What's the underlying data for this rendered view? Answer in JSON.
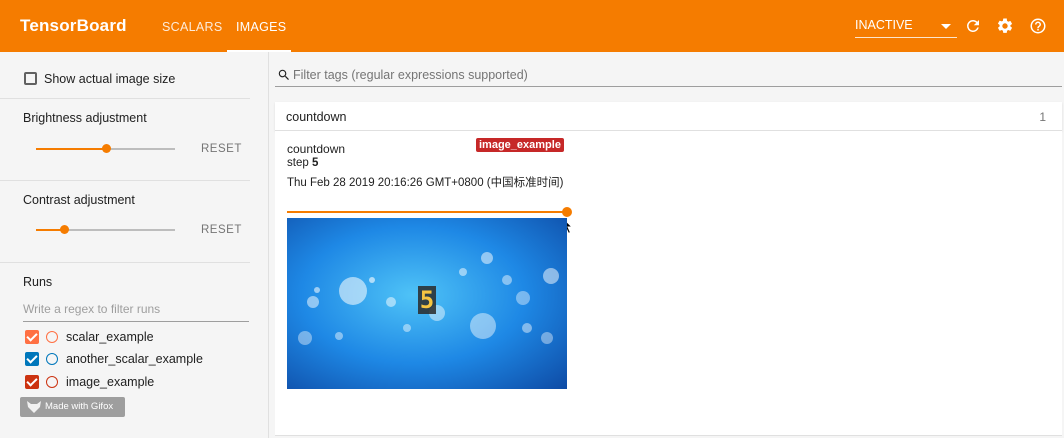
{
  "header": {
    "brand": "TensorBoard",
    "tabs": [
      {
        "label": "SCALARS",
        "active": false
      },
      {
        "label": "IMAGES",
        "active": true
      }
    ],
    "run_selector_value": "INACTIVE",
    "icons": [
      "refresh-icon",
      "gear-icon",
      "help-icon"
    ],
    "accent_color": "#f57c00"
  },
  "sidebar": {
    "show_actual_size_label": "Show actual image size",
    "brightness": {
      "label": "Brightness adjustment",
      "reset": "RESET",
      "value_fraction": 0.5
    },
    "contrast": {
      "label": "Contrast adjustment",
      "reset": "RESET",
      "value_fraction": 0.2
    },
    "runs": {
      "title": "Runs",
      "filter_placeholder": "Write a regex to filter runs",
      "items": [
        {
          "name": "scalar_example",
          "color": "#ff7043",
          "checked": true
        },
        {
          "name": "another_scalar_example",
          "color": "#0077bb",
          "checked": true
        },
        {
          "name": "image_example",
          "color": "#cc3311",
          "checked": true
        }
      ]
    },
    "watermark": "Made with Gifox"
  },
  "main": {
    "filter_placeholder": "Filter tags (regular expressions supported)",
    "category": {
      "name": "countdown",
      "count": "1"
    },
    "card": {
      "tag": "countdown",
      "step_label": "step",
      "step_value": "5",
      "timestamp": "Thu Feb 28 2019 20:16:26 GMT+0800 (中国标准时间)",
      "run_badge": "image_example",
      "image_digit": "5"
    }
  }
}
